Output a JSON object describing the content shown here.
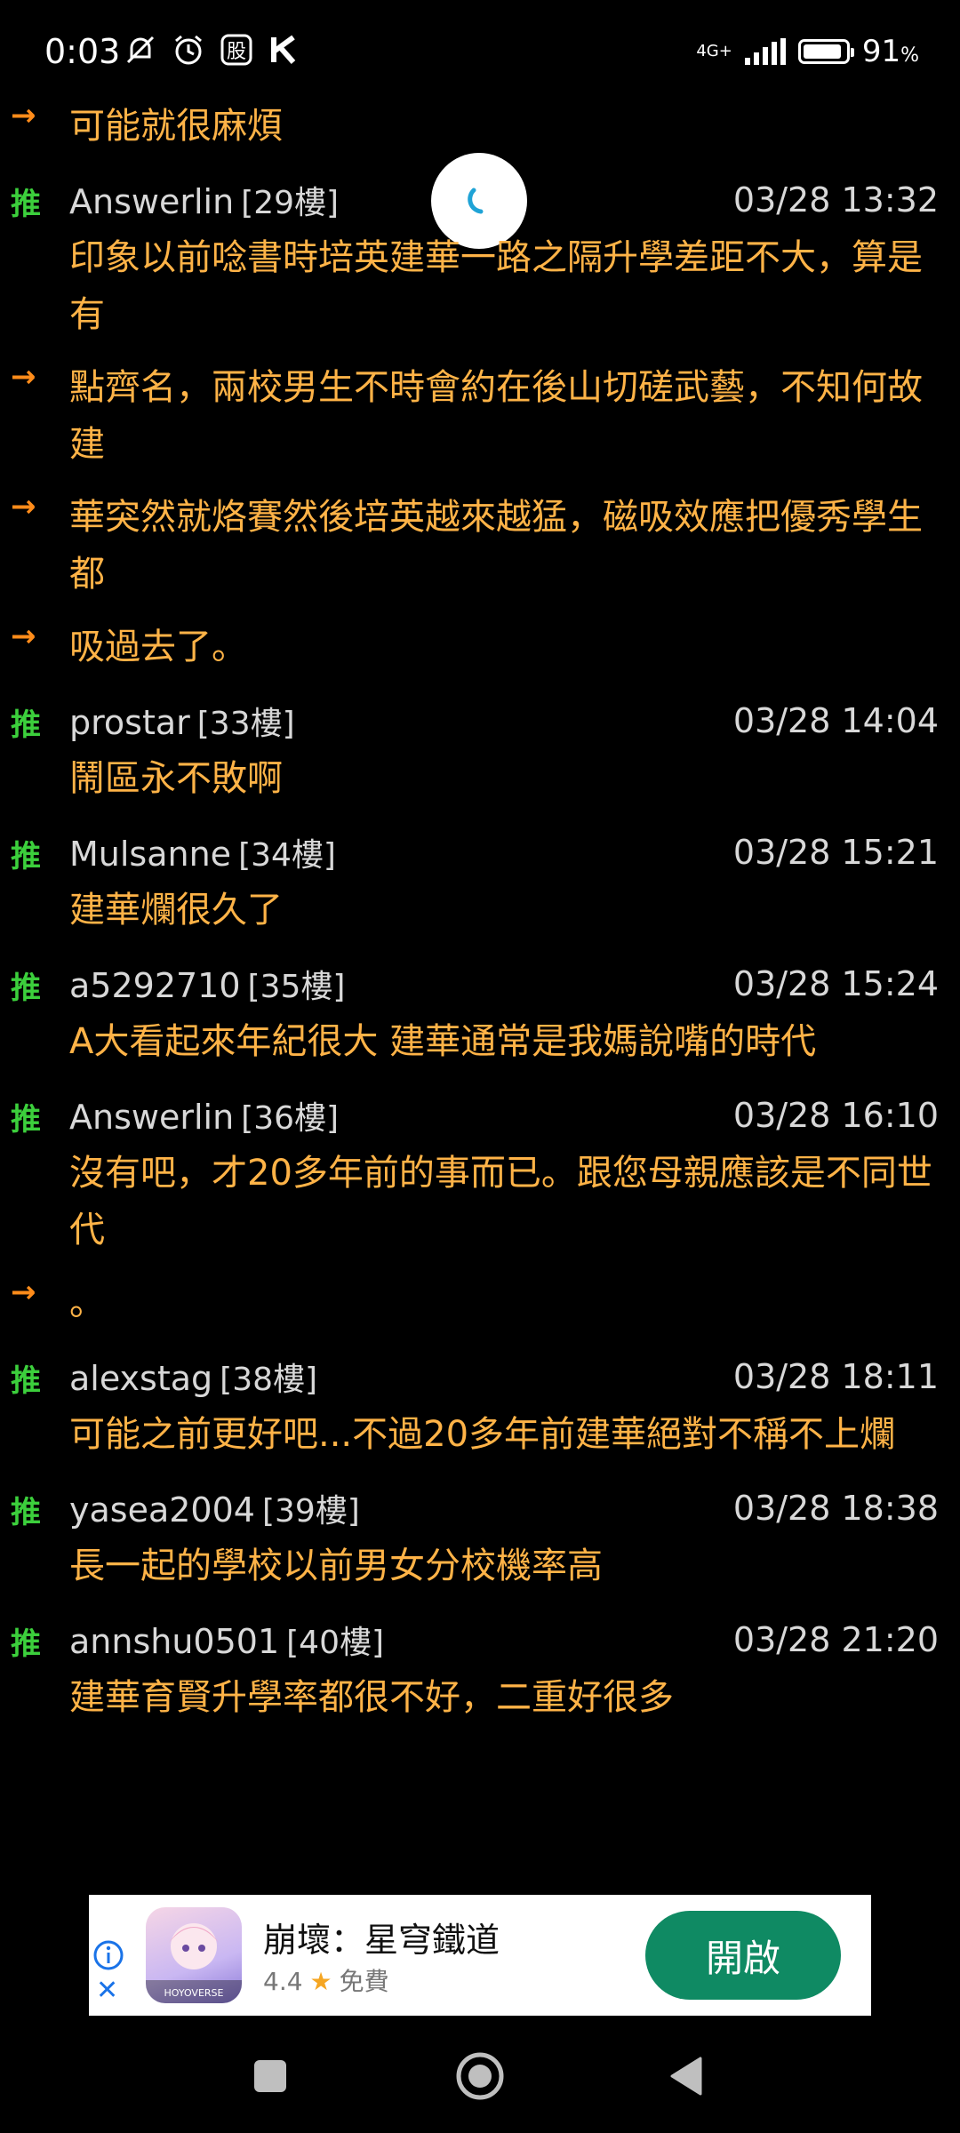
{
  "status_bar": {
    "time": "0:03",
    "network": "4G+",
    "battery": "91",
    "battery_unit": "%",
    "battery_level": 0.91,
    "icons": [
      "mute-icon",
      "alarm-icon",
      "stock-app-icon",
      "k-app-icon"
    ]
  },
  "comments": [
    {
      "type": "arrow",
      "text": "可能就很麻煩"
    },
    {
      "type": "push",
      "tag": "推",
      "user": "Answerlin",
      "floor": "[29樓]",
      "date": "03/28 13:32",
      "text": "印象以前唸書時培英建華一路之隔升學差距不大，算是有"
    },
    {
      "type": "arrow",
      "text": "點齊名，兩校男生不時會約在後山切磋武藝，不知何故建"
    },
    {
      "type": "arrow",
      "text": "華突然就烙賽然後培英越來越猛，磁吸效應把優秀學生都"
    },
    {
      "type": "arrow",
      "text": "吸過去了。"
    },
    {
      "type": "push",
      "tag": "推",
      "user": "prostar",
      "floor": "[33樓]",
      "date": "03/28 14:04",
      "text": "鬧區永不敗啊"
    },
    {
      "type": "push",
      "tag": "推",
      "user": "Mulsanne",
      "floor": "[34樓]",
      "date": "03/28 15:21",
      "text": "建華爛很久了"
    },
    {
      "type": "push",
      "tag": "推",
      "user": "a5292710",
      "floor": "[35樓]",
      "date": "03/28 15:24",
      "text": "A大看起來年紀很大  建華通常是我媽說嘴的時代"
    },
    {
      "type": "push",
      "tag": "推",
      "user": "Answerlin",
      "floor": "[36樓]",
      "date": "03/28 16:10",
      "text": "沒有吧，才20多年前的事而已。跟您母親應該是不同世代"
    },
    {
      "type": "arrow",
      "text": "。"
    },
    {
      "type": "push",
      "tag": "推",
      "user": "alexstag",
      "floor": "[38樓]",
      "date": "03/28 18:11",
      "text": "可能之前更好吧...不過20多年前建華絕對不稱不上爛"
    },
    {
      "type": "push",
      "tag": "推",
      "user": "yasea2004",
      "floor": "[39樓]",
      "date": "03/28 18:38",
      "text": "長一起的學校以前男女分校機率高"
    },
    {
      "type": "push",
      "tag": "推",
      "user": "annshu0501",
      "floor": "[40樓]",
      "date": "03/28 21:20",
      "text": "建華育賢升學率都很不好，二重好很多"
    }
  ],
  "arrow_symbol": "→",
  "ad": {
    "title": "崩壞：星穹鐵道",
    "rating": "4.4",
    "price": "免費",
    "button": "開啟",
    "app_brand": "HOYOVERSE",
    "close": "✕"
  }
}
